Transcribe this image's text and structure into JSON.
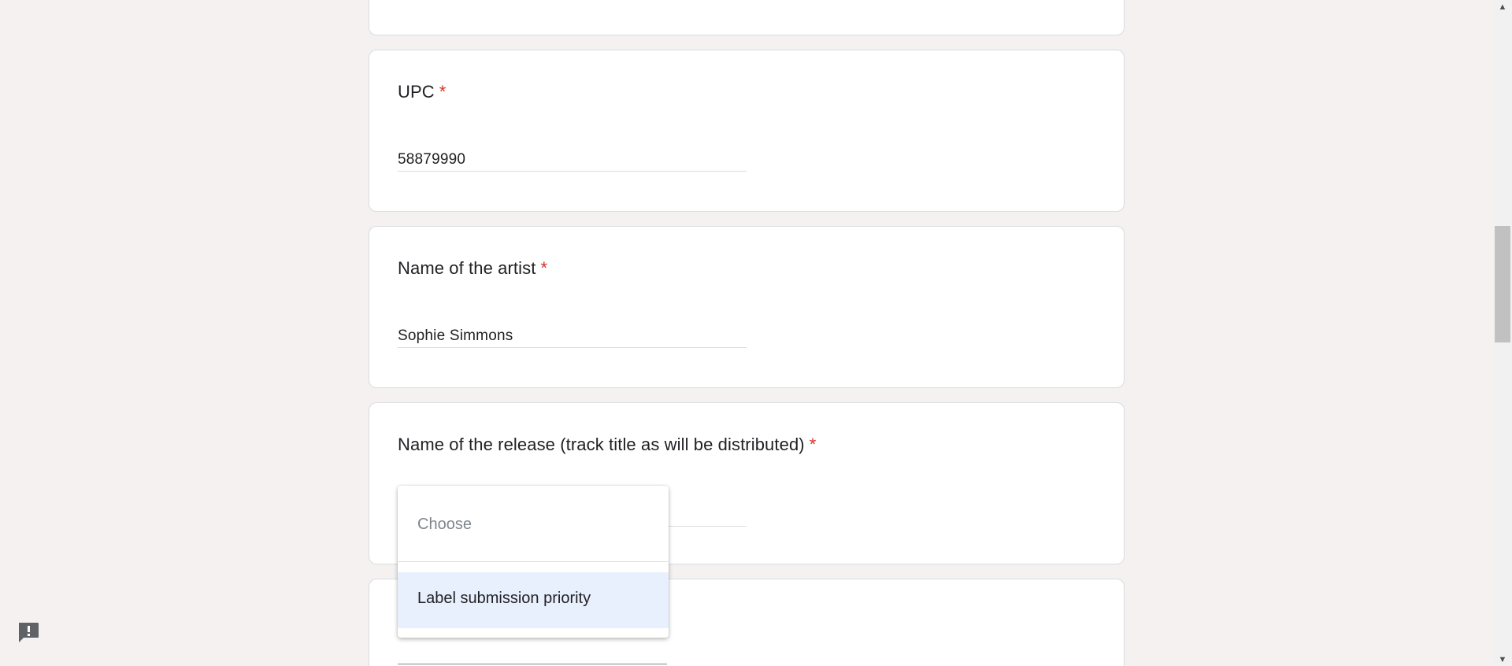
{
  "form": {
    "upc": {
      "title": "UPC",
      "required_mark": "*",
      "value": "58879990"
    },
    "artist": {
      "title": "Name of the artist",
      "required_mark": "*",
      "value": "Sophie Simmons"
    },
    "release": {
      "title": "Name of the release (track title as will be distributed)",
      "required_mark": "*"
    }
  },
  "dropdown": {
    "placeholder": "Choose",
    "options": [
      {
        "label": "Label submission priority",
        "highlighted": true
      }
    ]
  },
  "colors": {
    "page_background": "#f4f1f0",
    "required_mark": "#d93025",
    "highlight": "#e8f0fe"
  },
  "icons": {
    "feedback": "report-feedback-icon",
    "scroll_up": "scroll-up-arrow-icon",
    "scroll_down": "scroll-down-arrow-icon"
  }
}
